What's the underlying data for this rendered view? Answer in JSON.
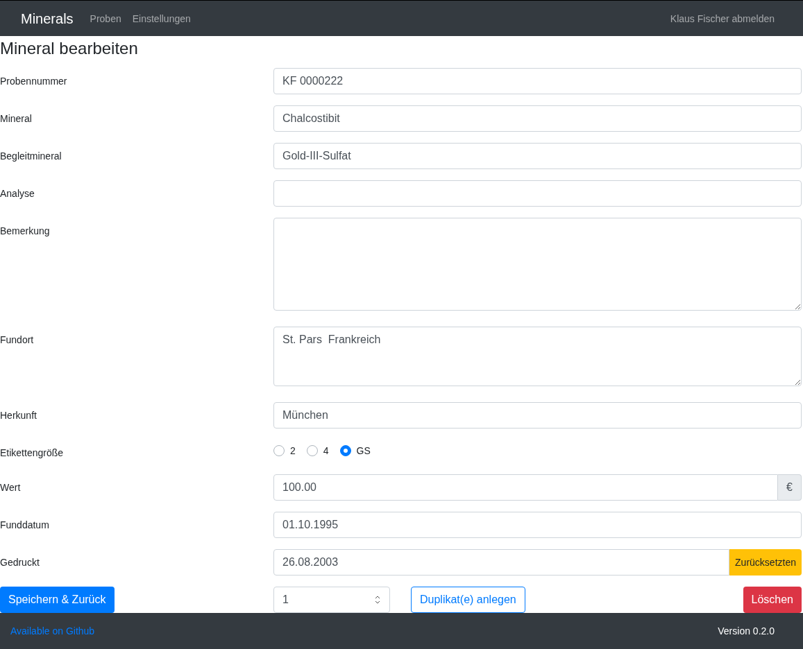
{
  "navbar": {
    "brand": "Minerals",
    "links": [
      {
        "label": "Proben"
      },
      {
        "label": "Einstellungen"
      }
    ],
    "logout": "Klaus Fischer abmelden"
  },
  "heading": "Mineral bearbeiten",
  "fields": [
    {
      "kind": "text",
      "label": "Probennummer",
      "value": "KF 0000222"
    },
    {
      "kind": "text",
      "label": "Mineral",
      "value": "Chalcostibit"
    },
    {
      "kind": "text",
      "label": "Begleitmineral",
      "value": "Gold-III-Sulfat"
    },
    {
      "kind": "text",
      "label": "Analyse"
    },
    {
      "kind": "memo",
      "label": "Bemerkung"
    },
    {
      "kind": "textarea",
      "label": "Fundort",
      "value": "St. Pars  Frankreich"
    },
    {
      "kind": "text",
      "label": "Herkunft",
      "value": "München"
    },
    {
      "kind": "radio",
      "label": "Etikettengröße",
      "options": [
        {
          "label": "2",
          "selected": false
        },
        {
          "label": "4",
          "selected": false
        },
        {
          "label": "GS",
          "selected": true
        }
      ]
    },
    {
      "kind": "addon",
      "label": "Wert",
      "value": "100.00",
      "addon": "€"
    },
    {
      "kind": "text",
      "label": "Funddatum",
      "value": "01.10.1995"
    },
    {
      "kind": "readonly",
      "label": "Gedruckt",
      "value": "26.08.2003",
      "button": "Zurücksetzten"
    }
  ],
  "actions": {
    "save": "Speichern & Zurück",
    "count": "1",
    "duplicate": "Duplikat(e) anlegen",
    "delete": "Löschen"
  },
  "footer": {
    "link": "Available on Github",
    "version": "Version 0.2.0"
  }
}
